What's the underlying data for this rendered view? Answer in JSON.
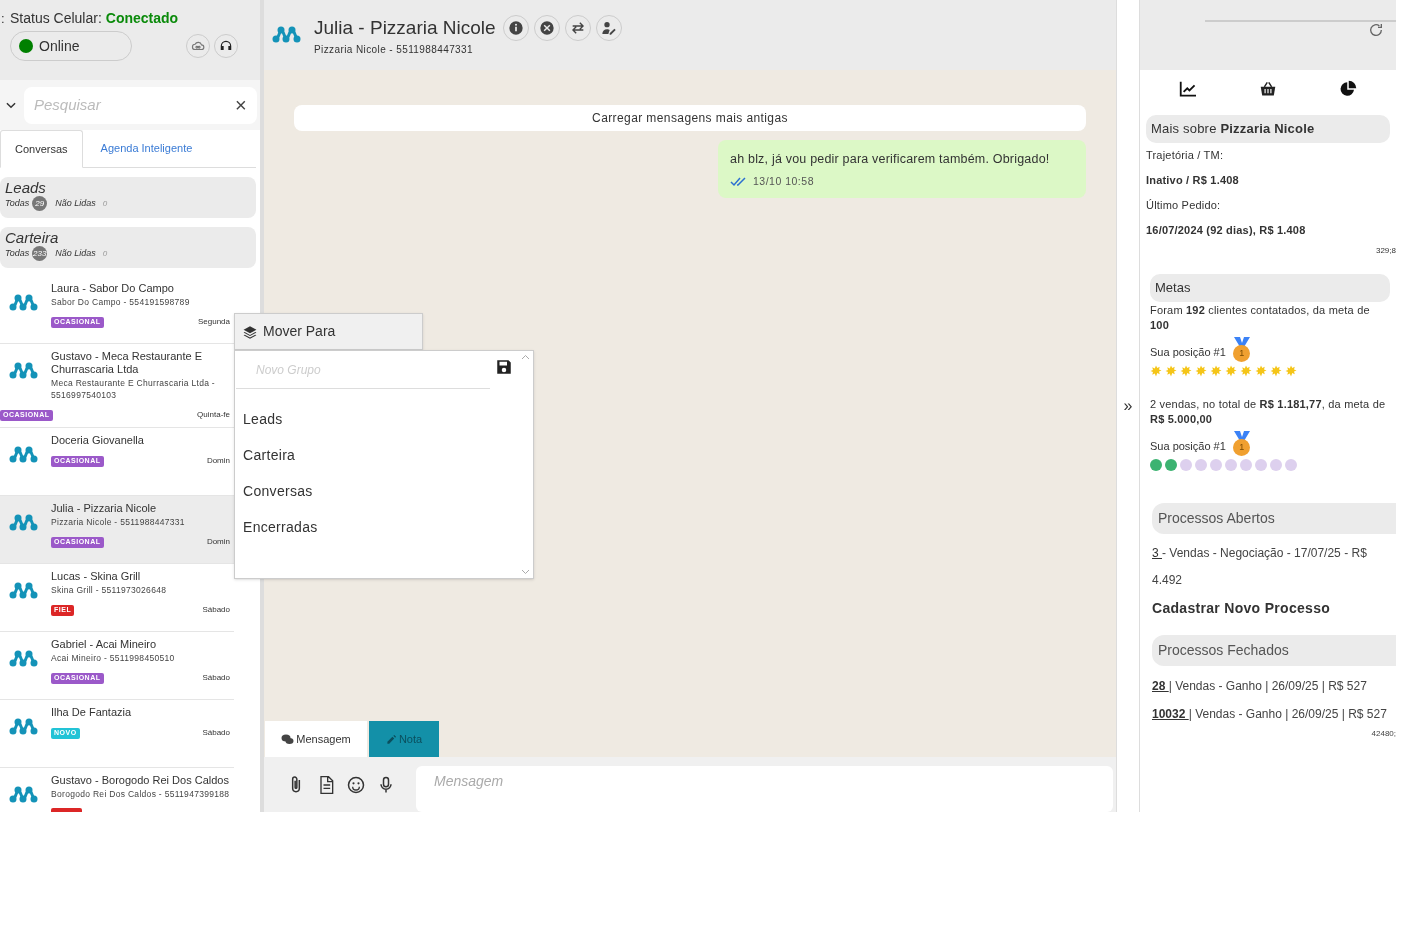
{
  "sidebar": {
    "edge_fragment": ":",
    "status_label": "Status Celular:",
    "status_value": "Conectado",
    "presence": {
      "label": "Online",
      "color": "#008000"
    },
    "search": {
      "placeholder": "Pesquisar",
      "clear": "×"
    },
    "tabs": [
      {
        "label": "Conversas",
        "selected": true
      },
      {
        "label": "Agenda Inteligente",
        "selected": false
      }
    ],
    "groups": [
      {
        "title": "Leads",
        "all_label": "Todas",
        "all_count": "29",
        "unread_label": "Não Lidas",
        "unread_count": "0"
      },
      {
        "title": "Carteira",
        "all_label": "Todas",
        "all_count": "233",
        "unread_label": "Não Lidas",
        "unread_count": "0"
      }
    ],
    "contacts": [
      {
        "name": "Laura - Sabor Do Campo",
        "subtitle": "Sabor Do Campo - 554191598789",
        "tag": {
          "label": "OCASIONAL",
          "color": "#9b59c9"
        },
        "day": "Segunda",
        "selected": false
      },
      {
        "name": "Gustavo - Meca Restaurante E Churrascaria Ltda",
        "subtitle": "Meca Restaurante E Churrascaria Ltda - 5516997540103",
        "tag": {
          "label": "OCASIONAL",
          "color": "#9b59c9"
        },
        "day": "Quinta-fe",
        "selected": false
      },
      {
        "name": "Doceria Giovanella",
        "tag": {
          "label": "OCASIONAL",
          "color": "#9b59c9"
        },
        "day": "Domin",
        "selected": false
      },
      {
        "name": "Julia - Pizzaria Nicole",
        "subtitle": "Pizzaria Nicole - 5511988447331",
        "tag": {
          "label": "OCASIONAL",
          "color": "#9b59c9"
        },
        "day": "Domin",
        "selected": true
      },
      {
        "name": "Lucas - Skina Grill",
        "subtitle": "Skina Grill - 5511973026648",
        "tag": {
          "label": "FIEL",
          "color": "#dc2626"
        },
        "day": "Sábado",
        "selected": false
      },
      {
        "name": "Gabriel - Acai Mineiro",
        "subtitle": "Acai Mineiro - 5511998450510",
        "tag": {
          "label": "OCASIONAL",
          "color": "#9b59c9"
        },
        "day": "Sábado",
        "selected": false
      },
      {
        "name": "Ilha De Fantazia",
        "tag": {
          "label": "NOVO",
          "color": "#22c3d6"
        },
        "day": "Sábado",
        "selected": false
      },
      {
        "name": "Gustavo - Borogodo Rei Dos Caldos",
        "subtitle": "Borogodo Rei Dos Caldos - 5511947399188",
        "tag": {
          "color": "#dc2626"
        },
        "selected": false
      }
    ]
  },
  "move_menu": {
    "title": "Mover Para",
    "new_group": {
      "placeholder": "Novo Grupo"
    },
    "options": [
      "Leads",
      "Carteira",
      "Conversas",
      "Encerradas"
    ]
  },
  "chat": {
    "title": "Julia - Pizzaria Nicole",
    "subtitle": "Pizzaria Nicole - 5511988447331",
    "load_older": "Carregar mensagens mais antigas",
    "messages": [
      {
        "text": "ah blz, já vou pedir para verificarem também. Obrigado!",
        "time": "13/10 10:58",
        "outgoing": true
      }
    ],
    "compose_tabs": [
      {
        "label": "Mensagem",
        "selected": false
      },
      {
        "label": "Nota",
        "selected": true
      }
    ],
    "input": {
      "placeholder": "Mensagem"
    }
  },
  "collapse": "»",
  "details": {
    "about": "Mais sobre **Pizzaria Nicole**",
    "lines": [
      "Trajetória / TM:",
      "**Inativo / R$ 1.408**",
      "Último Pedido:",
      "**16/07/2024 (92 dias), R$ 1.408**"
    ],
    "code_1": "329;8",
    "goals_title": "Metas",
    "goals": [
      {
        "text": "Foram **192** clientes contatados, da meta de **100**",
        "position": "Sua posição #1",
        "medal": "1",
        "stars": 10,
        "color": "#f5c518"
      },
      {
        "text": "2 vendas, no total de **R$ 1.181,77**, da meta de **R$ 5.000,00**",
        "position": "Sua posição #1",
        "medal": "1",
        "stars": 2,
        "color": "#3cb371"
      }
    ],
    "open_title": "Processos Abertos",
    "open": [
      {
        "id": "3 ",
        "text": "- Vendas - Negociação - 17/07/25 - R$ 4.492"
      }
    ],
    "new_process": "Cadastrar Novo Processo",
    "closed_title": "Processos Fechados",
    "closed": [
      {
        "id": "28 ",
        "text": "| Vendas - Ganho | 26/09/25 | R$ 527"
      },
      {
        "id": "10032 ",
        "text": "| Vendas - Ganho | 26/09/25 | R$ 527"
      }
    ],
    "code_2": "42480;"
  }
}
